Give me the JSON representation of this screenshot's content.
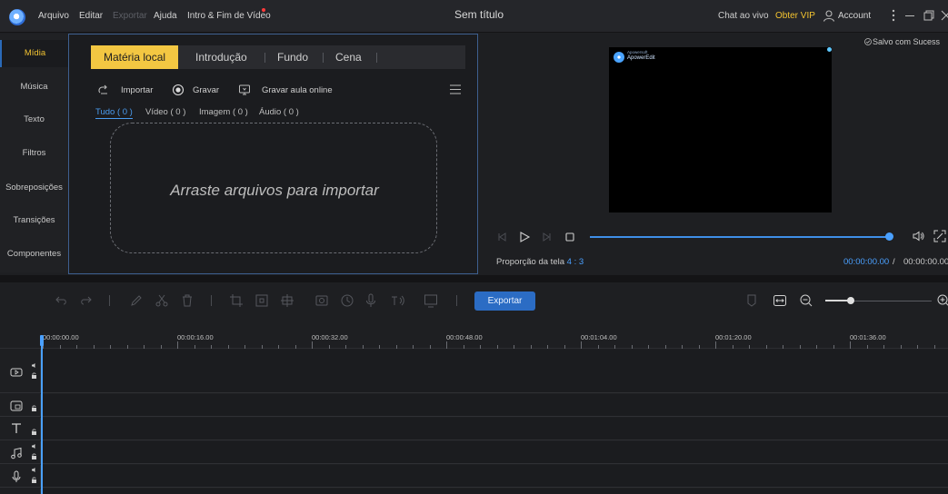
{
  "titlebar": {
    "menus": {
      "arquivo": "Arquivo",
      "editar": "Editar",
      "exportar": "Exportar",
      "ajuda": "Ajuda",
      "intro": "Intro & Fim de Vídeo"
    },
    "window_title": "Sem título",
    "chat": "Chat ao vivo",
    "vip": "Obter VIP",
    "account": "Account"
  },
  "sidebar": {
    "items": [
      {
        "label": "Mídia",
        "active": true
      },
      {
        "label": "Música"
      },
      {
        "label": "Texto"
      },
      {
        "label": "Filtros"
      },
      {
        "label": "Sobreposições"
      },
      {
        "label": "Transições"
      },
      {
        "label": "Componentes"
      }
    ]
  },
  "media": {
    "tabs": [
      {
        "label": "Matéria local",
        "active": true
      },
      {
        "label": "Introdução"
      },
      {
        "label": "Fundo"
      },
      {
        "label": "Cena"
      }
    ],
    "actions": {
      "import": "Importar",
      "record": "Gravar",
      "record_online": "Gravar aula online"
    },
    "filters": [
      "Tudo ( 0 )",
      "Vídeo ( 0 )",
      "Imagem ( 0 )",
      "Áudio ( 0 )"
    ],
    "drop_hint": "Arraste arquivos para importar"
  },
  "preview": {
    "saved_status": "Salvo com Sucess",
    "watermark_small": "Apowersoft",
    "watermark": "ApowerEdit",
    "aspect_label": "Proporção da tela",
    "aspect_value": "4 : 3",
    "time_current": "00:00:00.00",
    "time_separator": "/",
    "time_total": "00:00:00.00",
    "progress": 1.0
  },
  "timeline": {
    "export_label": "Exportar",
    "ruler": [
      "00:00:00.00",
      "00:00:16.00",
      "00:00:32.00",
      "00:00:48.00",
      "00:01:04.00",
      "00:01:20.00",
      "00:01:36.00"
    ],
    "zoom_level": 0.25
  },
  "colors": {
    "accent": "#f3c742",
    "blue": "#4aa0ff",
    "vip": "#f4c430"
  }
}
